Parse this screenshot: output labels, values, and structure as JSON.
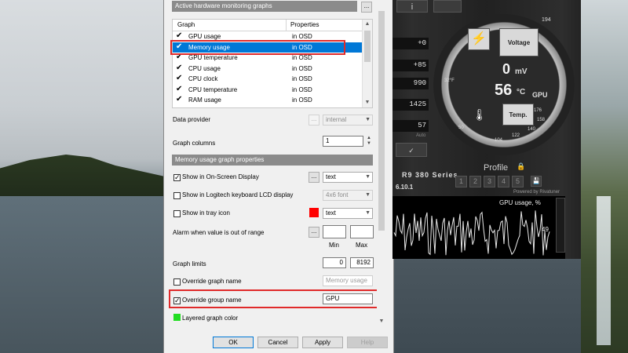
{
  "groups": {
    "active_graphs_title": "Active hardware monitoring graphs",
    "props_title": "Memory usage graph properties"
  },
  "graph_list": {
    "col_graph": "Graph",
    "col_properties": "Properties",
    "rows": [
      {
        "name": "GPU usage",
        "prop": "in OSD",
        "checked": true,
        "selected": false
      },
      {
        "name": "Memory usage",
        "prop": "in OSD",
        "checked": true,
        "selected": true
      },
      {
        "name": "GPU temperature",
        "prop": "in OSD",
        "checked": true,
        "selected": false
      },
      {
        "name": "CPU usage",
        "prop": "in OSD",
        "checked": true,
        "selected": false
      },
      {
        "name": "CPU clock",
        "prop": "in OSD",
        "checked": true,
        "selected": false
      },
      {
        "name": "CPU temperature",
        "prop": "in OSD",
        "checked": true,
        "selected": false
      },
      {
        "name": "RAM usage",
        "prop": "in OSD",
        "checked": true,
        "selected": false
      }
    ]
  },
  "data_provider": {
    "label": "Data provider",
    "value": "internal"
  },
  "graph_columns": {
    "label": "Graph columns",
    "value": "1"
  },
  "osd": {
    "label": "Show in On-Screen Display",
    "checked": true,
    "mode": "text"
  },
  "lcd": {
    "label": "Show in Logitech keyboard LCD display",
    "checked": false,
    "font": "4x6 font"
  },
  "tray": {
    "label": "Show in tray icon",
    "checked": false,
    "mode": "text",
    "color": "#ff0000"
  },
  "alarm": {
    "label": "Alarm when value is out of range",
    "min_label": "Min",
    "max_label": "Max",
    "min": "",
    "max": ""
  },
  "limits": {
    "label": "Graph limits",
    "min": "0",
    "max": "8192"
  },
  "override_name": {
    "label": "Override graph name",
    "checked": false,
    "placeholder": "Memory usage"
  },
  "override_group": {
    "label": "Override group name",
    "checked": true,
    "value": "GPU"
  },
  "layered": {
    "label": "Layered graph color",
    "color": "#22dd22"
  },
  "buttons": {
    "ok": "OK",
    "cancel": "Cancel",
    "apply": "Apply",
    "help": "Help",
    "dots": "..."
  },
  "afterburner": {
    "voltage_label": "Voltage",
    "voltage_value": "0",
    "voltage_unit": "mV",
    "temp_value": "56",
    "temp_unit": "°C",
    "temp_label": "Temp.",
    "gpu_label": "GPU",
    "deg_label": "32°F",
    "scale_ticks": [
      "194",
      "176",
      "158",
      "140",
      "122",
      "104",
      "50"
    ],
    "values": [
      "+0",
      "+85",
      "990",
      "1425",
      "57"
    ],
    "auto_label": "Auto",
    "card": "R9 380 Series",
    "driver": "6.10.1",
    "profile": "Profile",
    "profile_slots": [
      "1",
      "2",
      "3",
      "4",
      "5"
    ],
    "powered": "Powered by Rivatuner",
    "graph_title": "GPU usage, %",
    "graph_value": "49"
  }
}
